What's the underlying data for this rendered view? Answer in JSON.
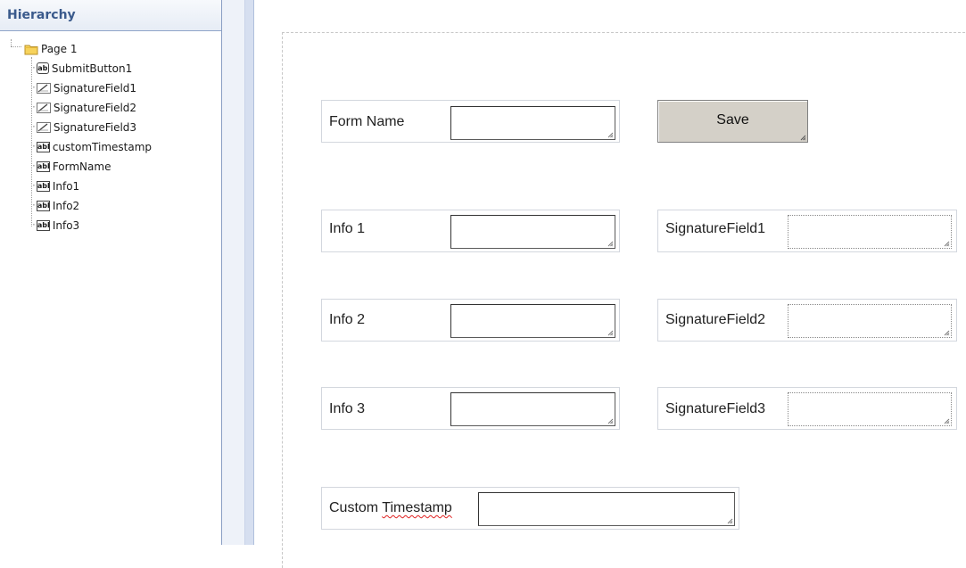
{
  "hierarchy": {
    "title": "Hierarchy",
    "root": {
      "label": "Page 1",
      "icon": "folder-icon"
    },
    "items": [
      {
        "label": "SubmitButton1",
        "icon": "button-ab-icon"
      },
      {
        "label": "SignatureField1",
        "icon": "signature-icon"
      },
      {
        "label": "SignatureField2",
        "icon": "signature-icon"
      },
      {
        "label": "SignatureField3",
        "icon": "signature-icon"
      },
      {
        "label": "customTimestamp",
        "icon": "textfield-abl-icon"
      },
      {
        "label": "FormName",
        "icon": "textfield-abl-icon"
      },
      {
        "label": "Info1",
        "icon": "textfield-abl-icon"
      },
      {
        "label": "Info2",
        "icon": "textfield-abl-icon"
      },
      {
        "label": "Info3",
        "icon": "textfield-abl-icon"
      }
    ],
    "icon_text": {
      "button": "ab",
      "textfield": "abl"
    }
  },
  "form": {
    "form_name_label": "Form Name",
    "save_label": "Save",
    "info1_label": "Info 1",
    "info2_label": "Info 2",
    "info3_label": "Info 3",
    "sig1_label": "SignatureField1",
    "sig2_label": "SignatureField2",
    "sig3_label": "SignatureField3",
    "timestamp_label_part1": "Custom ",
    "timestamp_label_part2": "Timestamp"
  },
  "colors": {
    "hierarchy_title": "#3a5a8c",
    "button_face": "#d4d0c8",
    "spellcheck_underline": "#e02020"
  }
}
